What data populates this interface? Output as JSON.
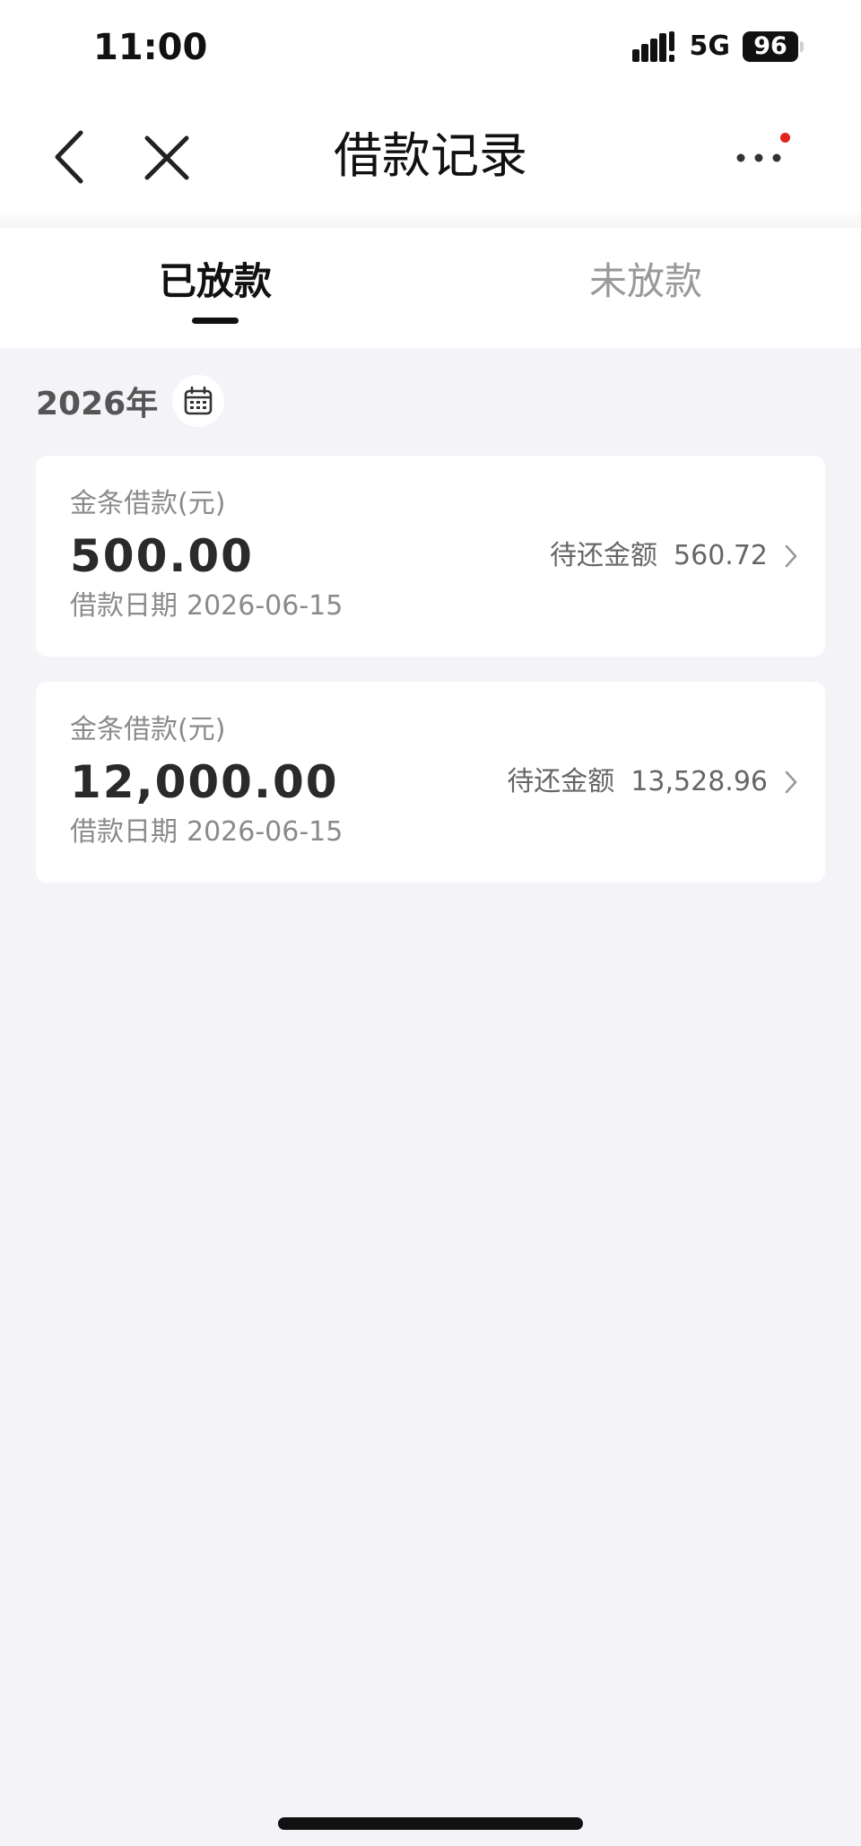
{
  "status_bar": {
    "time": "11:00",
    "network": "5G",
    "battery": "96"
  },
  "nav": {
    "title": "借款记录",
    "back_icon": "chevron-left-icon",
    "close_icon": "close-icon",
    "more_icon": "more-icon"
  },
  "tabs": [
    {
      "label": "已放款",
      "active": true
    },
    {
      "label": "未放款",
      "active": false
    }
  ],
  "filter": {
    "year": "2026年",
    "icon": "calendar-icon"
  },
  "loans": [
    {
      "type": "金条借款(元)",
      "amount": "500.00",
      "date_label": "借款日期",
      "date": "2026-06-15",
      "repay_label": "待还金额",
      "repay_amount": "560.72"
    },
    {
      "type": "金条借款(元)",
      "amount": "12,000.00",
      "date_label": "借款日期",
      "date": "2026-06-15",
      "repay_label": "待还金额",
      "repay_amount": "13,528.96"
    }
  ],
  "colors": {
    "background": "#f3f3f8",
    "card": "#ffffff",
    "notify_dot": "#e1251b",
    "text_primary": "#111111",
    "text_secondary": "#8a8a8a"
  }
}
